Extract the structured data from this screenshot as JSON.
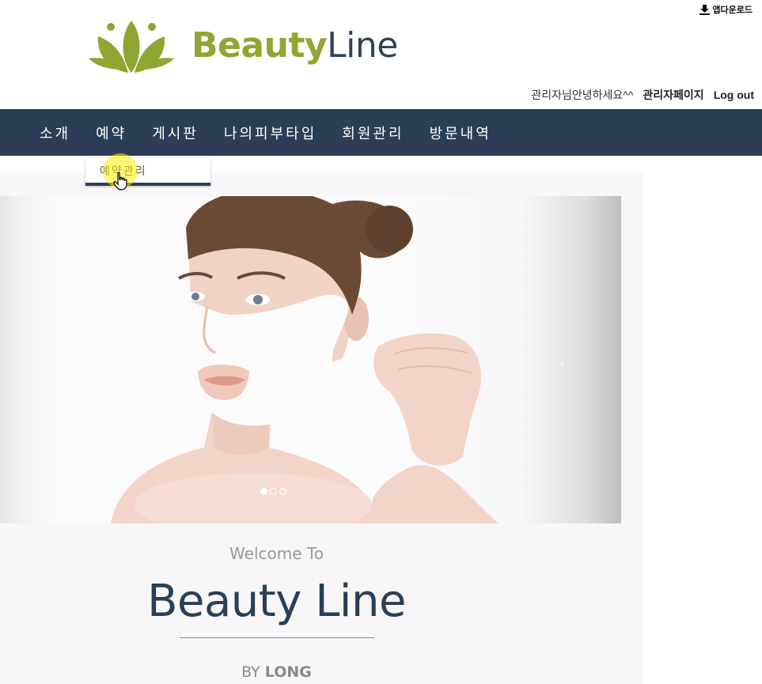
{
  "header": {
    "download_label": "앱다운로드",
    "logo": {
      "brand_part1": "Beauty",
      "brand_part2": "Line",
      "accent_color": "#8fa632",
      "text_color": "#33415a"
    },
    "user_bar": {
      "greeting": "관리자님안녕하세요^^",
      "admin_link": "관리자페이지",
      "logout_link": "Log out"
    }
  },
  "nav": {
    "background": "#2c3e55",
    "items": [
      "소개",
      "예약",
      "게시판",
      "나의피부타입",
      "회원관리",
      "방문내역"
    ],
    "dropdown": {
      "parent": "예약",
      "items": [
        "예약관리"
      ]
    }
  },
  "slider": {
    "next_icon": "›",
    "dots_total": 3,
    "active_dot": 1
  },
  "intro": {
    "welcome": "Welcome To",
    "title": "Beauty Line",
    "by_prefix": "BY",
    "by_name": "LONG"
  }
}
